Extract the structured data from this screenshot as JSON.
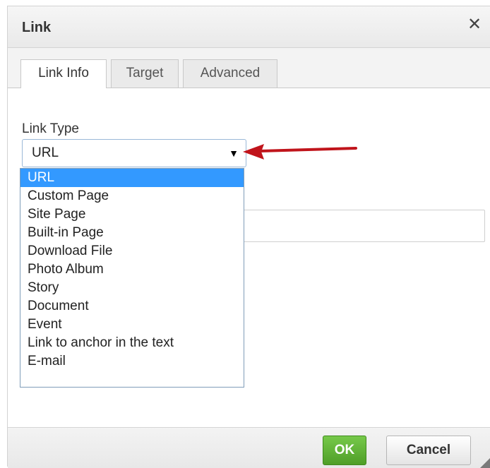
{
  "dialog": {
    "title": "Link",
    "close_glyph": "✕"
  },
  "tabs": [
    {
      "label": "Link Info",
      "active": true
    },
    {
      "label": "Target",
      "active": false
    },
    {
      "label": "Advanced",
      "active": false
    }
  ],
  "link_type": {
    "label": "Link Type",
    "selected": "URL",
    "caret": "▼",
    "options": [
      "URL",
      "Custom Page",
      "Site Page",
      "Built-in Page",
      "Download File",
      "Photo Album",
      "Story",
      "Document",
      "Event",
      "Link to anchor in the text",
      "E-mail"
    ]
  },
  "url_field": {
    "value": ""
  },
  "buttons": {
    "ok": "OK",
    "cancel": "Cancel"
  },
  "colors": {
    "ok_green": "#5cb031",
    "selection_blue": "#3399ff",
    "annotation_arrow": "#c0141b"
  },
  "icons": {
    "close": "close-icon",
    "caret": "caret-down-icon",
    "resize": "resize-grip-icon",
    "annotation": "red-arrow-icon"
  }
}
